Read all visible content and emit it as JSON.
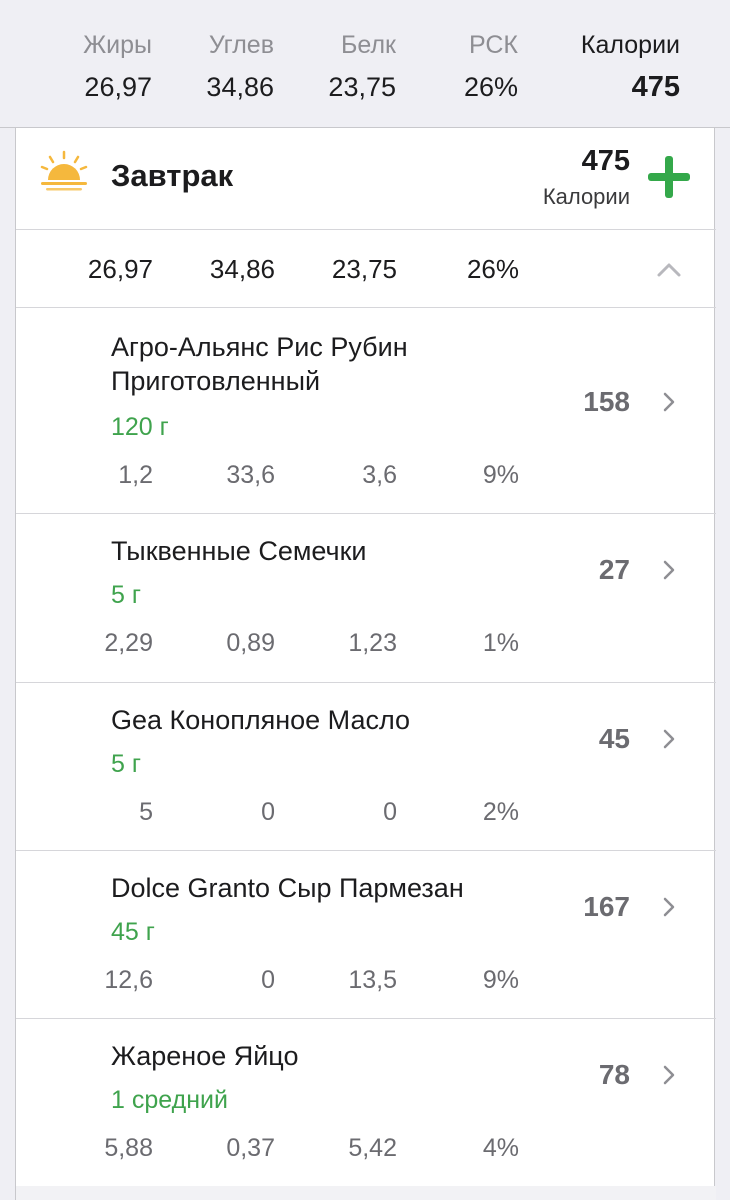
{
  "summary": {
    "labels": [
      "Жиры",
      "Углев",
      "Белк",
      "РСК",
      "Калории"
    ],
    "values": [
      "26,97",
      "34,86",
      "23,75",
      "26%",
      "475"
    ]
  },
  "meal": {
    "title": "Завтрак",
    "calories": "475",
    "calories_label": "Калории",
    "macros": [
      "26,97",
      "34,86",
      "23,75",
      "26%"
    ]
  },
  "items": [
    {
      "name": "Агро-Альянс Рис Рубин Приготовленный",
      "qty": "120 г",
      "calories": "158",
      "macros": [
        "1,2",
        "33,6",
        "3,6",
        "9%"
      ]
    },
    {
      "name": "Тыквенные Семечки",
      "qty": "5 г",
      "calories": "27",
      "macros": [
        "2,29",
        "0,89",
        "1,23",
        "1%"
      ]
    },
    {
      "name": "Gea Конопляное Масло",
      "qty": "5 г",
      "calories": "45",
      "macros": [
        "5",
        "0",
        "0",
        "2%"
      ]
    },
    {
      "name": "Dolce Granto Сыр Пармезан",
      "qty": "45 г",
      "calories": "167",
      "macros": [
        "12,6",
        "0",
        "13,5",
        "9%"
      ]
    },
    {
      "name": "Жареное Яйцо",
      "qty": "1 средний",
      "calories": "78",
      "macros": [
        "5,88",
        "0,37",
        "5,42",
        "4%"
      ]
    }
  ],
  "icons": {
    "sun": "sunrise-icon",
    "add": "plus-icon",
    "collapse": "chevron-up-icon",
    "detail": "chevron-right-icon"
  },
  "colors": {
    "accent_green": "#34a84a",
    "quantity_green": "#3fa34d",
    "sun_yellow": "#f5b83d"
  }
}
